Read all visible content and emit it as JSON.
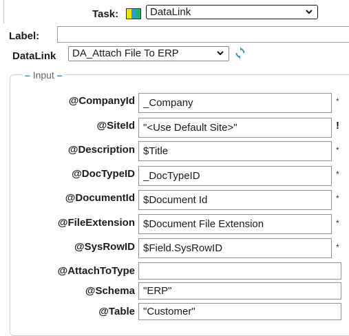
{
  "task": {
    "label": "Task:",
    "icon": "task-color-swatch-icon",
    "swatch_colors": [
      "#f5e600",
      "#2a9de0",
      "#1bb36a"
    ],
    "selected": "DataLink"
  },
  "label_field": {
    "label": "Label:",
    "value": ""
  },
  "datalink": {
    "label": "DataLink",
    "selected": "DA_Attach File To ERP",
    "refresh_icon": "refresh-icon"
  },
  "input_group": {
    "legend": "Input",
    "rows": [
      {
        "name": "@CompanyId",
        "value": "_Company",
        "marker": "*"
      },
      {
        "name": "@SiteId",
        "value": "\"<Use Default Site>\"",
        "marker": "!"
      },
      {
        "name": "@Description",
        "value": "$Title",
        "marker": "*"
      },
      {
        "name": "@DocTypeID",
        "value": "_DocTypeID",
        "marker": "*"
      },
      {
        "name": "@DocumentId",
        "value": "$Document Id",
        "marker": "*"
      },
      {
        "name": "@FileExtension",
        "value": "$Document File Extension",
        "marker": "*"
      },
      {
        "name": "@SysRowID",
        "value": "$Field.SysRowID",
        "marker": "*"
      },
      {
        "name": "@AttachToType",
        "value": "",
        "marker": ""
      },
      {
        "name": "@Schema",
        "value": "\"ERP\"",
        "marker": ""
      },
      {
        "name": "@Table",
        "value": "\"Customer\"",
        "marker": ""
      }
    ]
  }
}
